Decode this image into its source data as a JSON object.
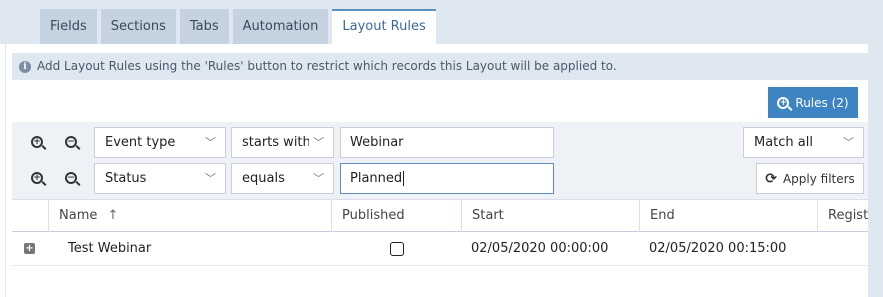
{
  "tabs": [
    "Fields",
    "Sections",
    "Tabs",
    "Automation",
    "Layout Rules"
  ],
  "active_tab": "Layout Rules",
  "info": {
    "icon": "info-icon",
    "text": "Add Layout Rules using the 'Rules' button to restrict which records this Layout will be applied to."
  },
  "rules_button": {
    "label": "Rules (2)",
    "icon": "zoom-in-icon"
  },
  "filters": [
    {
      "field": "Event type",
      "operator": "starts with",
      "value": "Webinar"
    },
    {
      "field": "Status",
      "operator": "equals",
      "value": "Planned"
    }
  ],
  "match": {
    "selected": "Match all"
  },
  "apply_filters": {
    "label": "Apply filters",
    "icon": "sync-icon"
  },
  "table": {
    "columns": [
      "Name",
      "Published",
      "Start",
      "End",
      "Registr"
    ],
    "sort_indicator": "↑",
    "rows": [
      {
        "name": "Test Webinar",
        "published": false,
        "start": "02/05/2020 00:00:00",
        "end": "02/05/2020 00:15:00",
        "registration": ""
      }
    ]
  },
  "colors": {
    "accent": "#3e83c2",
    "tab_bg": "#c5d3e0",
    "header_bg": "#dfe7f0",
    "filter_bg": "#eef2f6"
  }
}
